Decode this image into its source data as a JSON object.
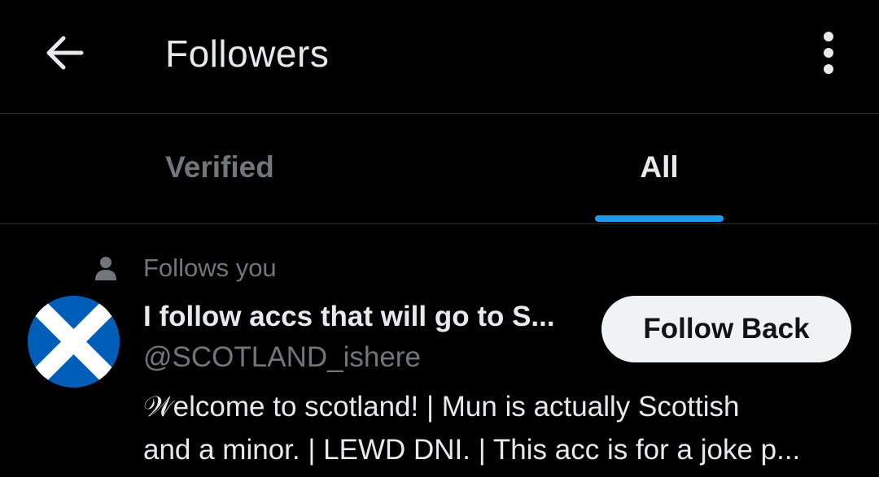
{
  "header": {
    "title": "Followers",
    "back_icon": "arrow-left-icon",
    "more_icon": "more-vertical-icon"
  },
  "tabs": [
    {
      "label": "Verified",
      "active": false
    },
    {
      "label": "All",
      "active": true
    }
  ],
  "colors": {
    "background": "#000000",
    "accent": "#1d9bf0",
    "secondary_text": "#71767b",
    "primary_text": "#e7e9ea",
    "button_bg": "#eff3f4",
    "flag_blue": "#005eb8"
  },
  "follower": {
    "context_icon": "person-icon",
    "context_text": "Follows you",
    "avatar": "scotland-flag-avatar",
    "display_name": "I follow accs that will go to S...",
    "handle": "@SCOTLAND_ishere",
    "follow_button": "Follow Back",
    "bio_line_1": "𝒲elcome to scotland! | Mun is actually Scottish",
    "bio_line_2": "and a minor. | LEWD DNI. | This acc is for a joke p..."
  }
}
